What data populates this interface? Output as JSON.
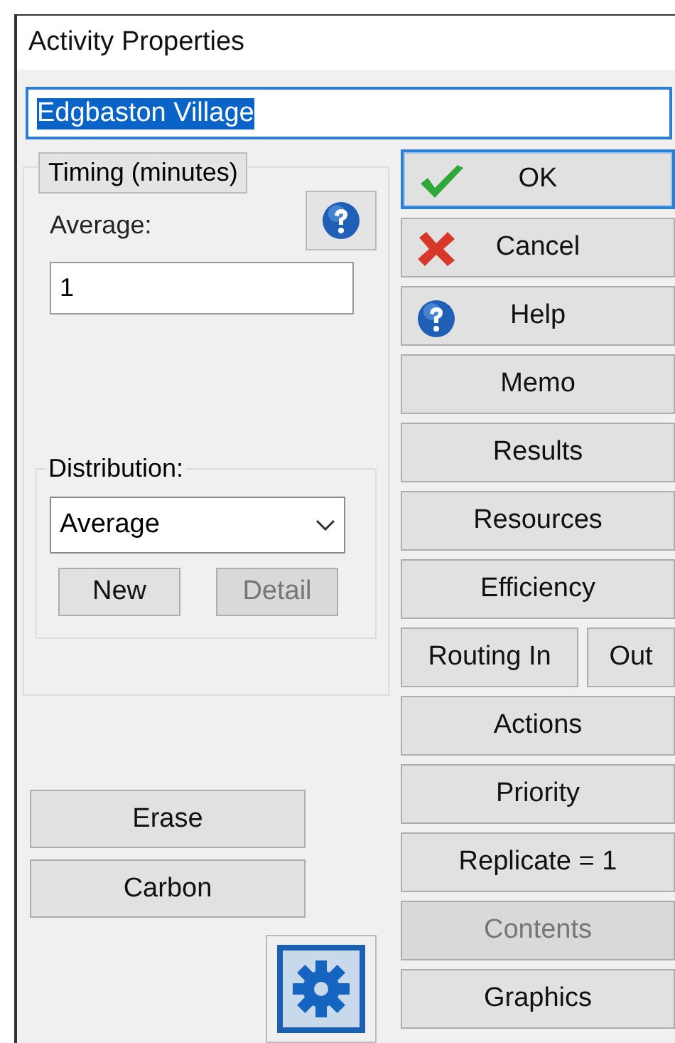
{
  "window": {
    "title": "Activity Properties"
  },
  "name_field": {
    "value": "Edgbaston Village",
    "selected": true
  },
  "timing": {
    "title": "Timing (minutes)",
    "average_label": "Average:",
    "average_value": "1",
    "distribution": {
      "label": "Distribution:",
      "value": "Average",
      "buttons": [
        {
          "label": "New",
          "disabled": false
        },
        {
          "label": "Detail",
          "disabled": true
        }
      ]
    }
  },
  "left_buttons": [
    {
      "label": "Erase"
    },
    {
      "label": "Carbon"
    }
  ],
  "right_buttons": [
    {
      "kind": "confirm",
      "label": "OK",
      "focused": true,
      "disabled": false
    },
    {
      "kind": "cancel",
      "label": "Cancel",
      "focused": false,
      "disabled": false
    },
    {
      "kind": "help",
      "label": "Help",
      "focused": false,
      "disabled": false
    },
    {
      "kind": "plain",
      "label": "Memo",
      "focused": false,
      "disabled": false
    },
    {
      "kind": "plain",
      "label": "Results",
      "focused": false,
      "disabled": false
    },
    {
      "kind": "plain",
      "label": "Resources",
      "focused": false,
      "disabled": false
    },
    {
      "kind": "plain",
      "label": "Efficiency",
      "focused": false,
      "disabled": false
    },
    {
      "kind": "split",
      "labels": [
        "Routing In",
        "Out"
      ],
      "focused": false,
      "disabled": false
    },
    {
      "kind": "plain",
      "label": "Actions",
      "focused": false,
      "disabled": false
    },
    {
      "kind": "plain",
      "label": "Priority",
      "focused": false,
      "disabled": false
    },
    {
      "kind": "plain",
      "label": "Replicate = 1",
      "focused": false,
      "disabled": false
    },
    {
      "kind": "plain",
      "label": "Contents",
      "focused": false,
      "disabled": true
    },
    {
      "kind": "plain",
      "label": "Graphics",
      "focused": false,
      "disabled": false
    }
  ]
}
